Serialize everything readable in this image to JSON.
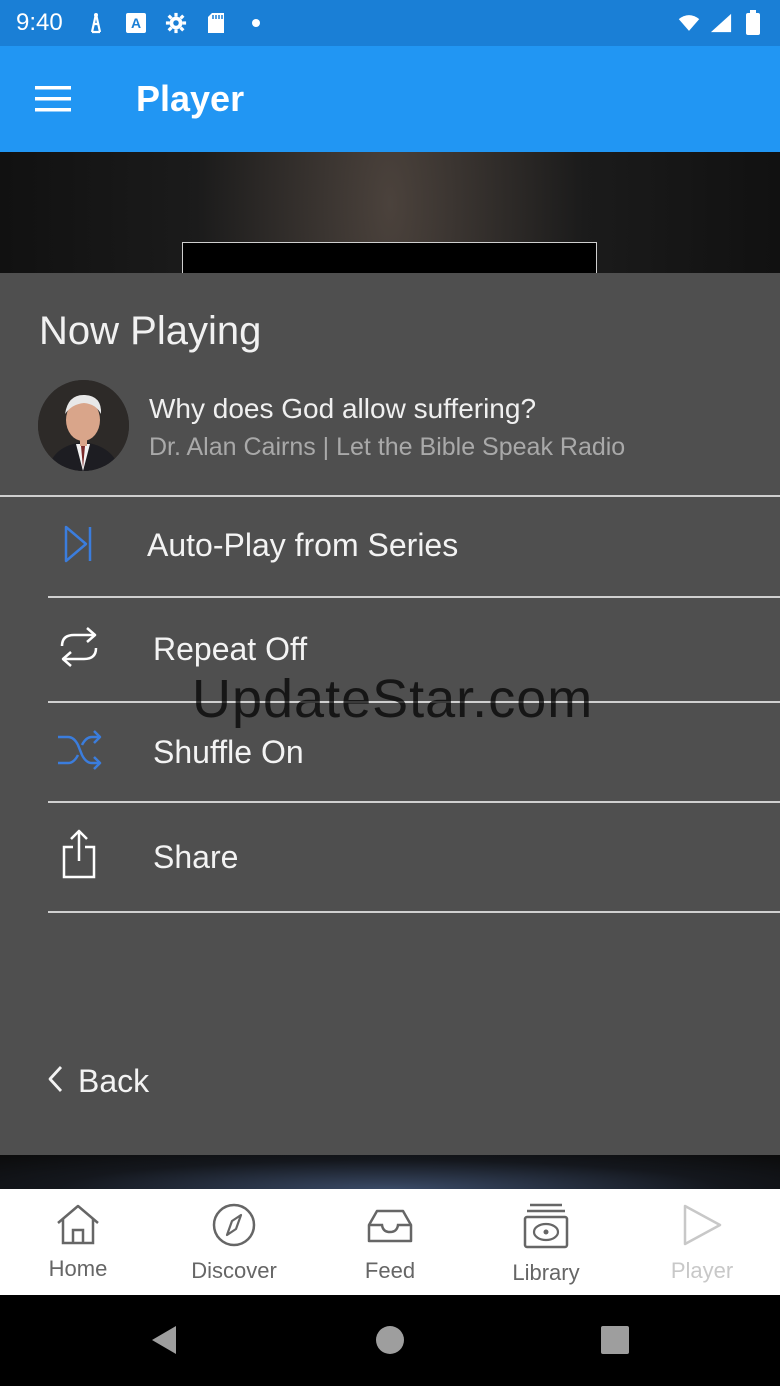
{
  "status_bar": {
    "time": "9:40",
    "left_icons": [
      "tower-icon",
      "a-badge-icon",
      "gear-icon",
      "sd-card-icon",
      "dot-icon"
    ],
    "right_icons": [
      "wifi-icon",
      "signal-icon",
      "battery-icon"
    ]
  },
  "app_bar": {
    "title": "Player",
    "menu_icon": "hamburger-menu-icon"
  },
  "sheet": {
    "title": "Now Playing",
    "track": {
      "title": "Why does God allow suffering?",
      "subtitle": "Dr. Alan Cairns | Let the Bible Speak Radio"
    },
    "options": [
      {
        "label": "Auto-Play from Series",
        "icon": "skip-next-icon",
        "color": "#3b7ddd"
      },
      {
        "label": "Repeat Off",
        "icon": "repeat-icon",
        "color": "#ffffff"
      },
      {
        "label": "Shuffle On",
        "icon": "shuffle-icon",
        "color": "#3b7ddd"
      },
      {
        "label": "Share",
        "icon": "share-icon",
        "color": "#ffffff"
      }
    ],
    "back_label": "Back"
  },
  "watermark": "UpdateStar.com",
  "bottom_nav": [
    {
      "label": "Home",
      "icon": "home-icon"
    },
    {
      "label": "Discover",
      "icon": "compass-icon"
    },
    {
      "label": "Feed",
      "icon": "inbox-icon"
    },
    {
      "label": "Library",
      "icon": "library-icon"
    },
    {
      "label": "Player",
      "icon": "play-icon",
      "disabled": true
    }
  ],
  "colors": {
    "app_bar": "#2196f3",
    "status_bar": "#1a7fd6",
    "sheet": "#4f4f4f",
    "accent_icon": "#3b7ddd"
  }
}
